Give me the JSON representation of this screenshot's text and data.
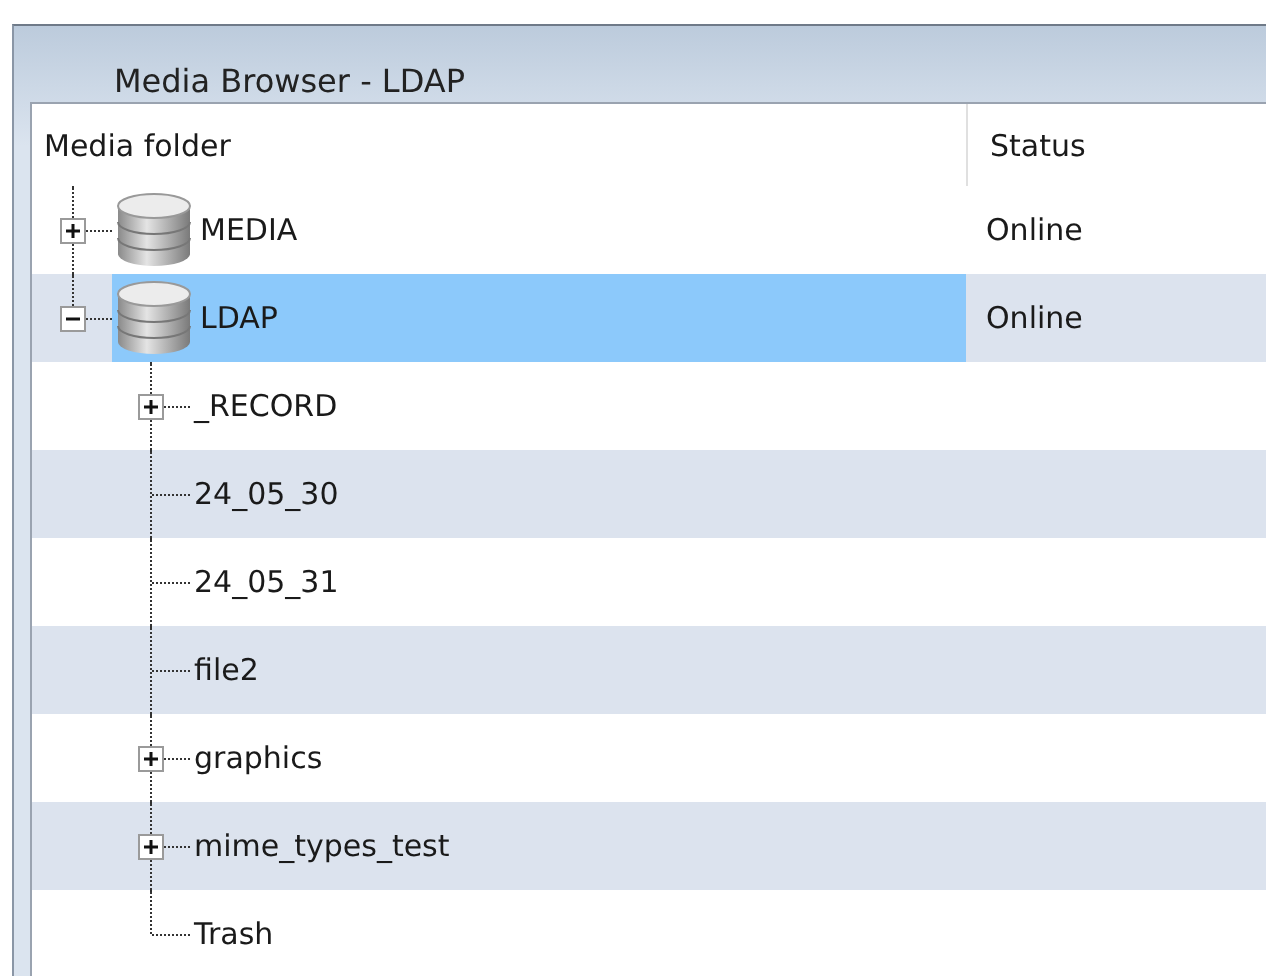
{
  "title": "Media Browser - LDAP",
  "columns": [
    "Media folder",
    "Status"
  ],
  "tree": [
    {
      "label": "MEDIA",
      "kind": "database",
      "status": "Online",
      "expanded": false,
      "selected": false
    },
    {
      "label": "LDAP",
      "kind": "database",
      "status": "Online",
      "expanded": true,
      "selected": true,
      "children": [
        {
          "label": "_RECORD",
          "expanded": false,
          "selected": false
        },
        {
          "label": "24_05_30",
          "selected": false
        },
        {
          "label": "24_05_31",
          "selected": false
        },
        {
          "label": "file2",
          "selected": false
        },
        {
          "label": "graphics",
          "expanded": false,
          "selected": false
        },
        {
          "label": "mime_types_test",
          "expanded": false,
          "selected": false
        },
        {
          "label": "Trash",
          "selected": false
        }
      ]
    }
  ]
}
